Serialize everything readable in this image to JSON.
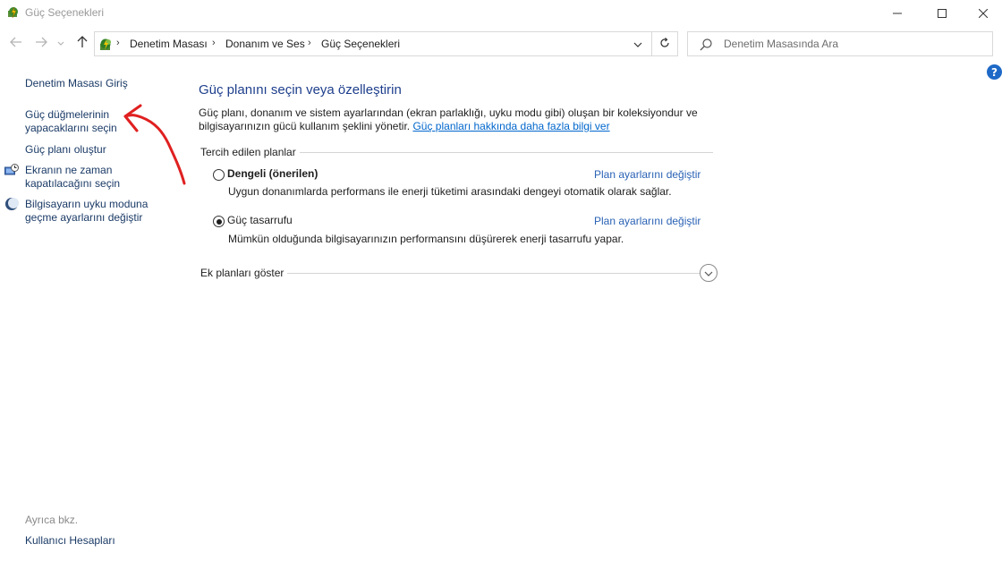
{
  "window": {
    "title": "Güç Seçenekleri"
  },
  "nav": {
    "breadcrumbs": [
      "Denetim Masası",
      "Donanım ve Ses",
      "Güç Seçenekleri"
    ],
    "search_placeholder": "Denetim Masasında Ara",
    "help_label": "?"
  },
  "left_pane": {
    "home": "Denetim Masası Giriş",
    "links": [
      "Güç düğmelerinin",
      "yapacaklarını seçin",
      "Güç planı oluştur",
      "Ekranın ne zaman",
      "kapatılacağını seçin",
      "Bilgisayarın uyku moduna",
      "geçme ayarlarını değiştir"
    ],
    "see_also": "Ayrıca bkz.",
    "user_accounts": "Kullanıcı Hesapları"
  },
  "main": {
    "title": "Güç planını seçin veya özelleştirin",
    "intro_line1": "Güç planı, donanım ve sistem ayarlarından (ekran parlaklığı, uyku modu gibi) oluşan bir koleksiyondur ve",
    "intro_line2": "bilgisayarınızın gücü kullanım şeklini yönetir.",
    "intro_link": "Güç planları hakkında daha fazla bilgi ver",
    "preferred_label": "Tercih edilen planlar",
    "plans": [
      {
        "name": "Dengeli (önerilen)",
        "description": "Uygun donanımlarda performans ile enerji tüketimi arasındaki dengeyi otomatik olarak sağlar.",
        "link": "Plan ayarlarını değiştir",
        "selected": false
      },
      {
        "name": "Güç tasarrufu",
        "description": "Mümkün olduğunda bilgisayarınızın performansını düşürerek enerji tasarrufu yapar.",
        "link": "Plan ayarlarını değiştir",
        "selected": true
      }
    ],
    "show_more": "Ek planları göster"
  },
  "colors": {
    "link": "#1a3a66",
    "heading": "#1e3f8c",
    "annotation": "#e02020"
  }
}
